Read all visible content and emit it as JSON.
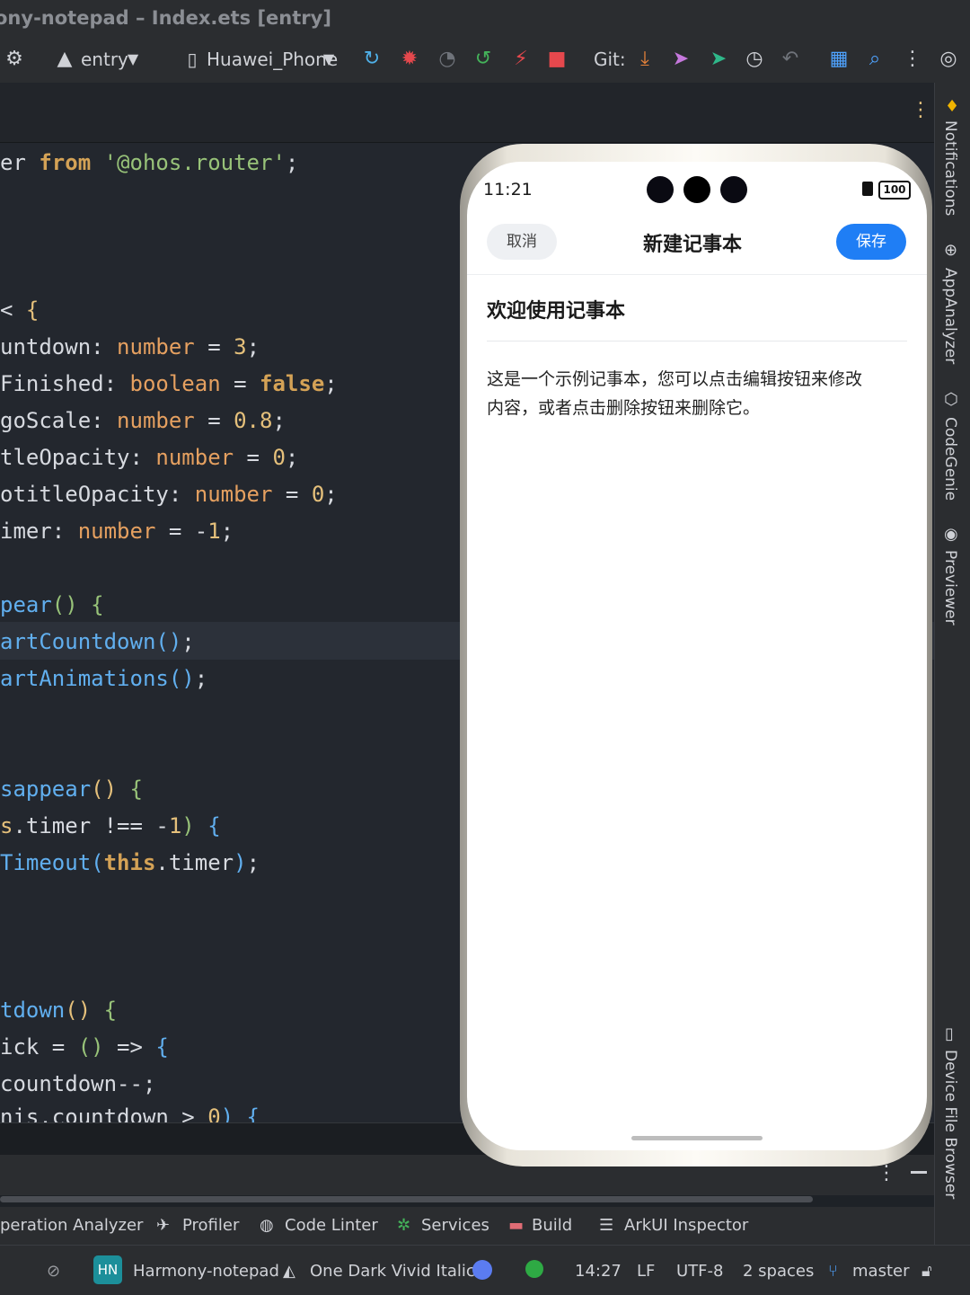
{
  "window": {
    "title": "ony-notepad – Index.ets [entry]"
  },
  "toolbar": {
    "module": "entry",
    "device": "Huawei_Phone",
    "git_label": "Git:"
  },
  "code_lines": [
    [
      [
        "pl",
        "er "
      ],
      [
        "kw",
        "from"
      ],
      [
        "pl",
        " "
      ],
      [
        "str",
        "'@ohos.router'"
      ],
      [
        "pl",
        ";"
      ]
    ],
    [],
    [],
    [
      [
        "pl",
        "< "
      ],
      [
        "br1",
        "{"
      ]
    ],
    [
      [
        "pl",
        "untdown: "
      ],
      [
        "ty",
        "number"
      ],
      [
        "pl",
        " = "
      ],
      [
        "num",
        "3"
      ],
      [
        "pl",
        ";"
      ]
    ],
    [
      [
        "pl",
        "Finished: "
      ],
      [
        "ty",
        "boolean"
      ],
      [
        "pl",
        " = "
      ],
      [
        "kw",
        "false"
      ],
      [
        "pl",
        ";"
      ]
    ],
    [
      [
        "pl",
        "goScale: "
      ],
      [
        "ty",
        "number"
      ],
      [
        "pl",
        " = "
      ],
      [
        "num",
        "0.8"
      ],
      [
        "pl",
        ";"
      ]
    ],
    [
      [
        "pl",
        "tleOpacity: "
      ],
      [
        "ty",
        "number"
      ],
      [
        "pl",
        " = "
      ],
      [
        "num",
        "0"
      ],
      [
        "pl",
        ";"
      ]
    ],
    [
      [
        "pl",
        "otitleOpacity: "
      ],
      [
        "ty",
        "number"
      ],
      [
        "pl",
        " = "
      ],
      [
        "num",
        "0"
      ],
      [
        "pl",
        ";"
      ]
    ],
    [
      [
        "pl",
        "imer: "
      ],
      [
        "ty",
        "number"
      ],
      [
        "pl",
        " = -"
      ],
      [
        "num",
        "1"
      ],
      [
        "pl",
        ";"
      ]
    ],
    [],
    [
      [
        "fn",
        "pear"
      ],
      [
        "br2",
        "()"
      ],
      [
        "pl",
        " "
      ],
      [
        "br2",
        "{"
      ]
    ],
    [
      [
        "fn",
        "artCountdown"
      ],
      [
        "br3",
        "()"
      ],
      [
        "pl",
        ";"
      ]
    ],
    [
      [
        "fn",
        "artAnimations"
      ],
      [
        "br3",
        "()"
      ],
      [
        "pl",
        ";"
      ]
    ],
    [],
    [],
    [
      [
        "fn",
        "sappear"
      ],
      [
        "br1",
        "()"
      ],
      [
        "pl",
        " "
      ],
      [
        "br2",
        "{"
      ]
    ],
    [
      [
        "id",
        "s"
      ],
      [
        "pl",
        ".timer !== -"
      ],
      [
        "num",
        "1"
      ],
      [
        "br2",
        ")"
      ],
      [
        "pl",
        " "
      ],
      [
        "br3",
        "{"
      ]
    ],
    [
      [
        "fn",
        "Timeout"
      ],
      [
        "br3",
        "("
      ],
      [
        "kw",
        "this"
      ],
      [
        "pl",
        ".timer"
      ],
      [
        "br3",
        ")"
      ],
      [
        "pl",
        ";"
      ]
    ],
    [],
    [],
    [],
    [
      [
        "fn",
        "tdown"
      ],
      [
        "br1",
        "()"
      ],
      [
        "pl",
        " "
      ],
      [
        "br2",
        "{"
      ]
    ],
    [
      [
        "pl",
        "ick = "
      ],
      [
        "br2",
        "()"
      ],
      [
        "pl",
        " => "
      ],
      [
        "br3",
        "{"
      ]
    ],
    [
      [
        "pl",
        "countdown--;"
      ]
    ],
    [
      [
        "pl",
        "nis.countdown > "
      ],
      [
        "num",
        "0"
      ],
      [
        "br3",
        ")"
      ],
      [
        "pl",
        " "
      ],
      [
        "br3",
        "{"
      ]
    ]
  ],
  "phone": {
    "time": "11:21",
    "battery": "100",
    "cancel_label": "取消",
    "header_title": "新建记事本",
    "save_label": "保存",
    "note_title": "欢迎使用记事本",
    "note_body_line1": "这是一个示例记事本，您可以点击编辑按钮来修改",
    "note_body_line2": "内容，或者点击删除按钮来删除它。"
  },
  "right_tools": [
    "Notifications",
    "AppAnalyzer",
    "CodeGenie",
    "Previewer",
    "Device File Browser"
  ],
  "tool_windows": [
    "peration Analyzer",
    "Profiler",
    "Code Linter",
    "Services",
    "Build",
    "ArkUI Inspector"
  ],
  "status": {
    "project_badge": "HN",
    "project": "Harmony-notepad",
    "theme": "One Dark Vivid Italic",
    "time": "14:27",
    "line_sep": "LF",
    "encoding": "UTF-8",
    "indent": "2 spaces",
    "branch": "master"
  },
  "colors": {
    "accent_blue": "#1f7ef5",
    "editor_bg": "#23272e"
  }
}
